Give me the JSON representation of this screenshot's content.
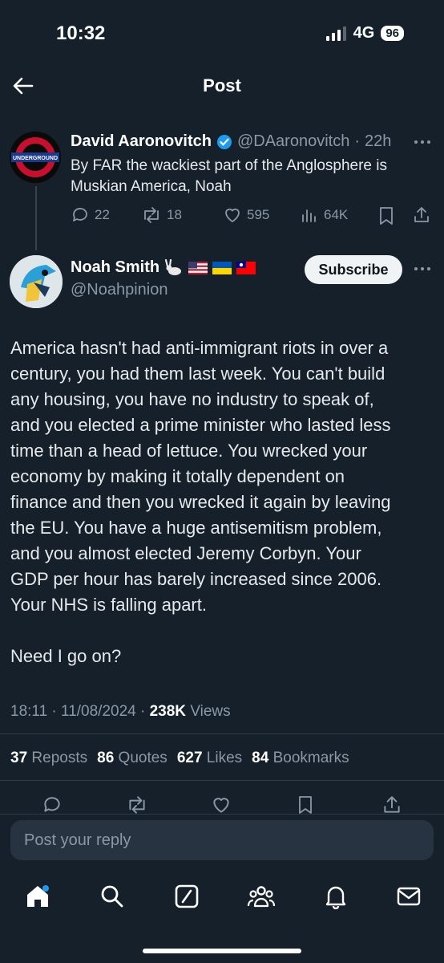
{
  "status": {
    "time": "10:32",
    "network": "4G",
    "battery": "96"
  },
  "header": {
    "title": "Post"
  },
  "parent_post": {
    "author": "David Aaronovitch",
    "handle": "@DAaronovitch",
    "age": "22h",
    "text_line1": "By FAR the wackiest part of the Anglosphere is",
    "text_line2": "Muskian America, Noah",
    "replies": "22",
    "reposts": "18",
    "likes": "595",
    "views": "64K",
    "avatar_text": "UNDERGROUND"
  },
  "main_post": {
    "author": "Noah Smith",
    "handle": "@Noahpinion",
    "subscribe_label": "Subscribe",
    "lines": [
      "America hasn't had anti-immigrant riots in over a",
      "century, you had them last week. You can't build",
      "any housing, you have no industry to speak of,",
      "and you elected a prime minister who lasted less",
      "time than a head of lettuce. You wrecked your",
      "economy by making it totally dependent on",
      "finance and then you wrecked it again by leaving",
      "the EU. You have a huge antisemitism problem,",
      "and you almost elected Jeremy Corbyn. Your",
      "GDP per hour has barely increased since 2006.",
      "Your NHS is falling apart."
    ],
    "closing": "Need I go on?",
    "time": "18:11",
    "date": "11/08/2024",
    "views_count": "238K",
    "views_label": "Views",
    "reposts_count": "37",
    "reposts_label": "Reposts",
    "quotes_count": "86",
    "quotes_label": "Quotes",
    "likes_count": "627",
    "likes_label": "Likes",
    "bookmarks_count": "84",
    "bookmarks_label": "Bookmarks"
  },
  "reply": {
    "placeholder": "Post your reply"
  },
  "colors": {
    "background": "#15202b",
    "accent": "#1d9bf0",
    "muted": "#8b98a5"
  }
}
